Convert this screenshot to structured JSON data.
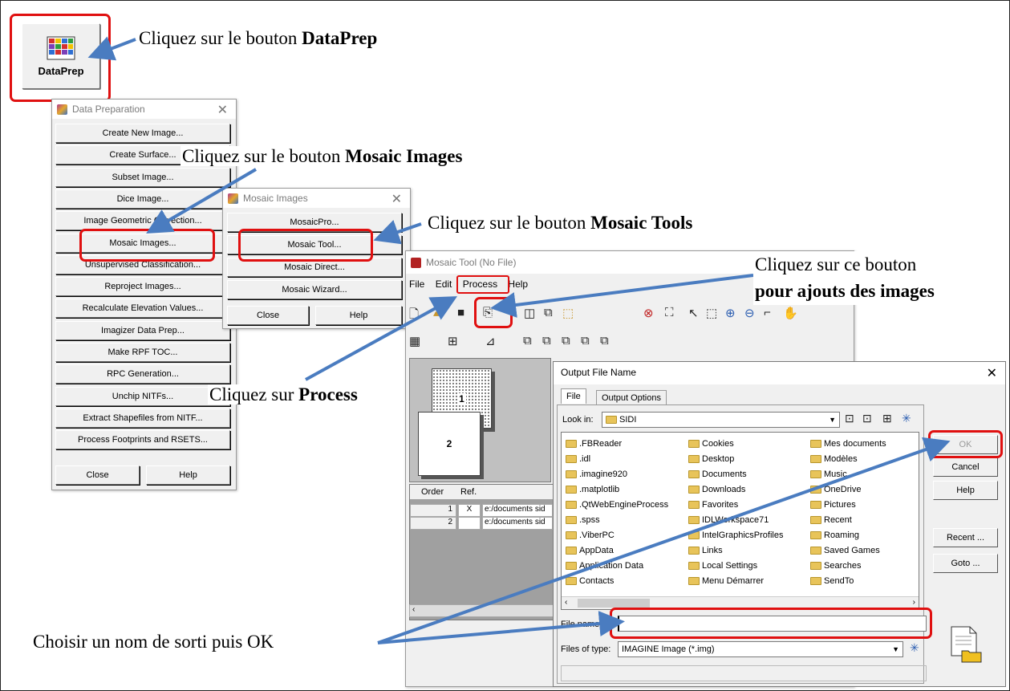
{
  "annotations": {
    "dataprep": {
      "prefix": "Cliquez sur le bouton ",
      "bold": "DataPrep"
    },
    "mosaic_images": {
      "prefix": "Cliquez sur le bouton ",
      "bold": "Mosaic Images"
    },
    "mosaic_tools": {
      "prefix": "Cliquez sur le bouton ",
      "bold": "Mosaic Tools"
    },
    "add_images": {
      "line1": "Cliquez sur ce bouton",
      "line2": "pour ajouts des images"
    },
    "process": {
      "prefix": "Cliquez sur ",
      "bold": "Process"
    },
    "output": {
      "text": "Choisir un nom de sorti puis OK"
    }
  },
  "dataprep_button": {
    "label": "DataPrep"
  },
  "data_preparation": {
    "title": "Data Preparation",
    "items": [
      "Create New Image...",
      "Create Surface...",
      "Subset Image...",
      "Dice Image...",
      "Image Geometric Correction...",
      "Mosaic Images...",
      "Unsupervised Classification...",
      "Reproject Images...",
      "Recalculate Elevation Values...",
      "Imagizer Data Prep...",
      "Make RPF TOC...",
      "RPC Generation...",
      "Unchip NITFs...",
      "Extract Shapefiles from NITF...",
      "Process Footprints and RSETS..."
    ],
    "close": "Close",
    "help": "Help"
  },
  "mosaic_images": {
    "title": "Mosaic Images",
    "items": [
      "MosaicPro...",
      "Mosaic Tool...",
      "Mosaic Direct...",
      "Mosaic Wizard..."
    ],
    "close": "Close",
    "help": "Help"
  },
  "mosaic_tool": {
    "title": "Mosaic Tool (No File)",
    "menu": [
      "File",
      "Edit",
      "Process",
      "Help"
    ],
    "tiles": [
      "1",
      "2"
    ],
    "table": {
      "headers": [
        "Order",
        "Ref."
      ],
      "rows": [
        {
          "order": "1",
          "ref": "X",
          "path": "e:/documents sid"
        },
        {
          "order": "2",
          "ref": "",
          "path": "e:/documents sid"
        }
      ]
    }
  },
  "output_dialog": {
    "title": "Output File Name",
    "tabs": [
      "File",
      "Output Options"
    ],
    "look_in_label": "Look in:",
    "look_in_value": "SIDI",
    "columns": [
      [
        ".FBReader",
        ".idl",
        ".imagine920",
        ".matplotlib",
        ".QtWebEngineProcess",
        ".spss",
        ".ViberPC",
        "AppData",
        "Application Data",
        "Contacts"
      ],
      [
        "Cookies",
        "Desktop",
        "Documents",
        "Downloads",
        "Favorites",
        "IDLWorkspace71",
        "IntelGraphicsProfiles",
        "Links",
        "Local Settings",
        "Menu Démarrer"
      ],
      [
        "Mes documents",
        "Modèles",
        "Music",
        "OneDrive",
        "Pictures",
        "Recent",
        "Roaming",
        "Saved Games",
        "Searches",
        "SendTo"
      ]
    ],
    "buttons": {
      "ok": "OK",
      "cancel": "Cancel",
      "help": "Help",
      "recent": "Recent ...",
      "goto": "Goto ..."
    },
    "file_name_label": "File name:",
    "file_name_value": "",
    "files_of_type_label": "Files of type:",
    "files_of_type_value": "IMAGINE Image (*.img)"
  },
  "colors": {
    "annotation_red": "#e01010",
    "arrow_blue": "#4a7cc0"
  }
}
